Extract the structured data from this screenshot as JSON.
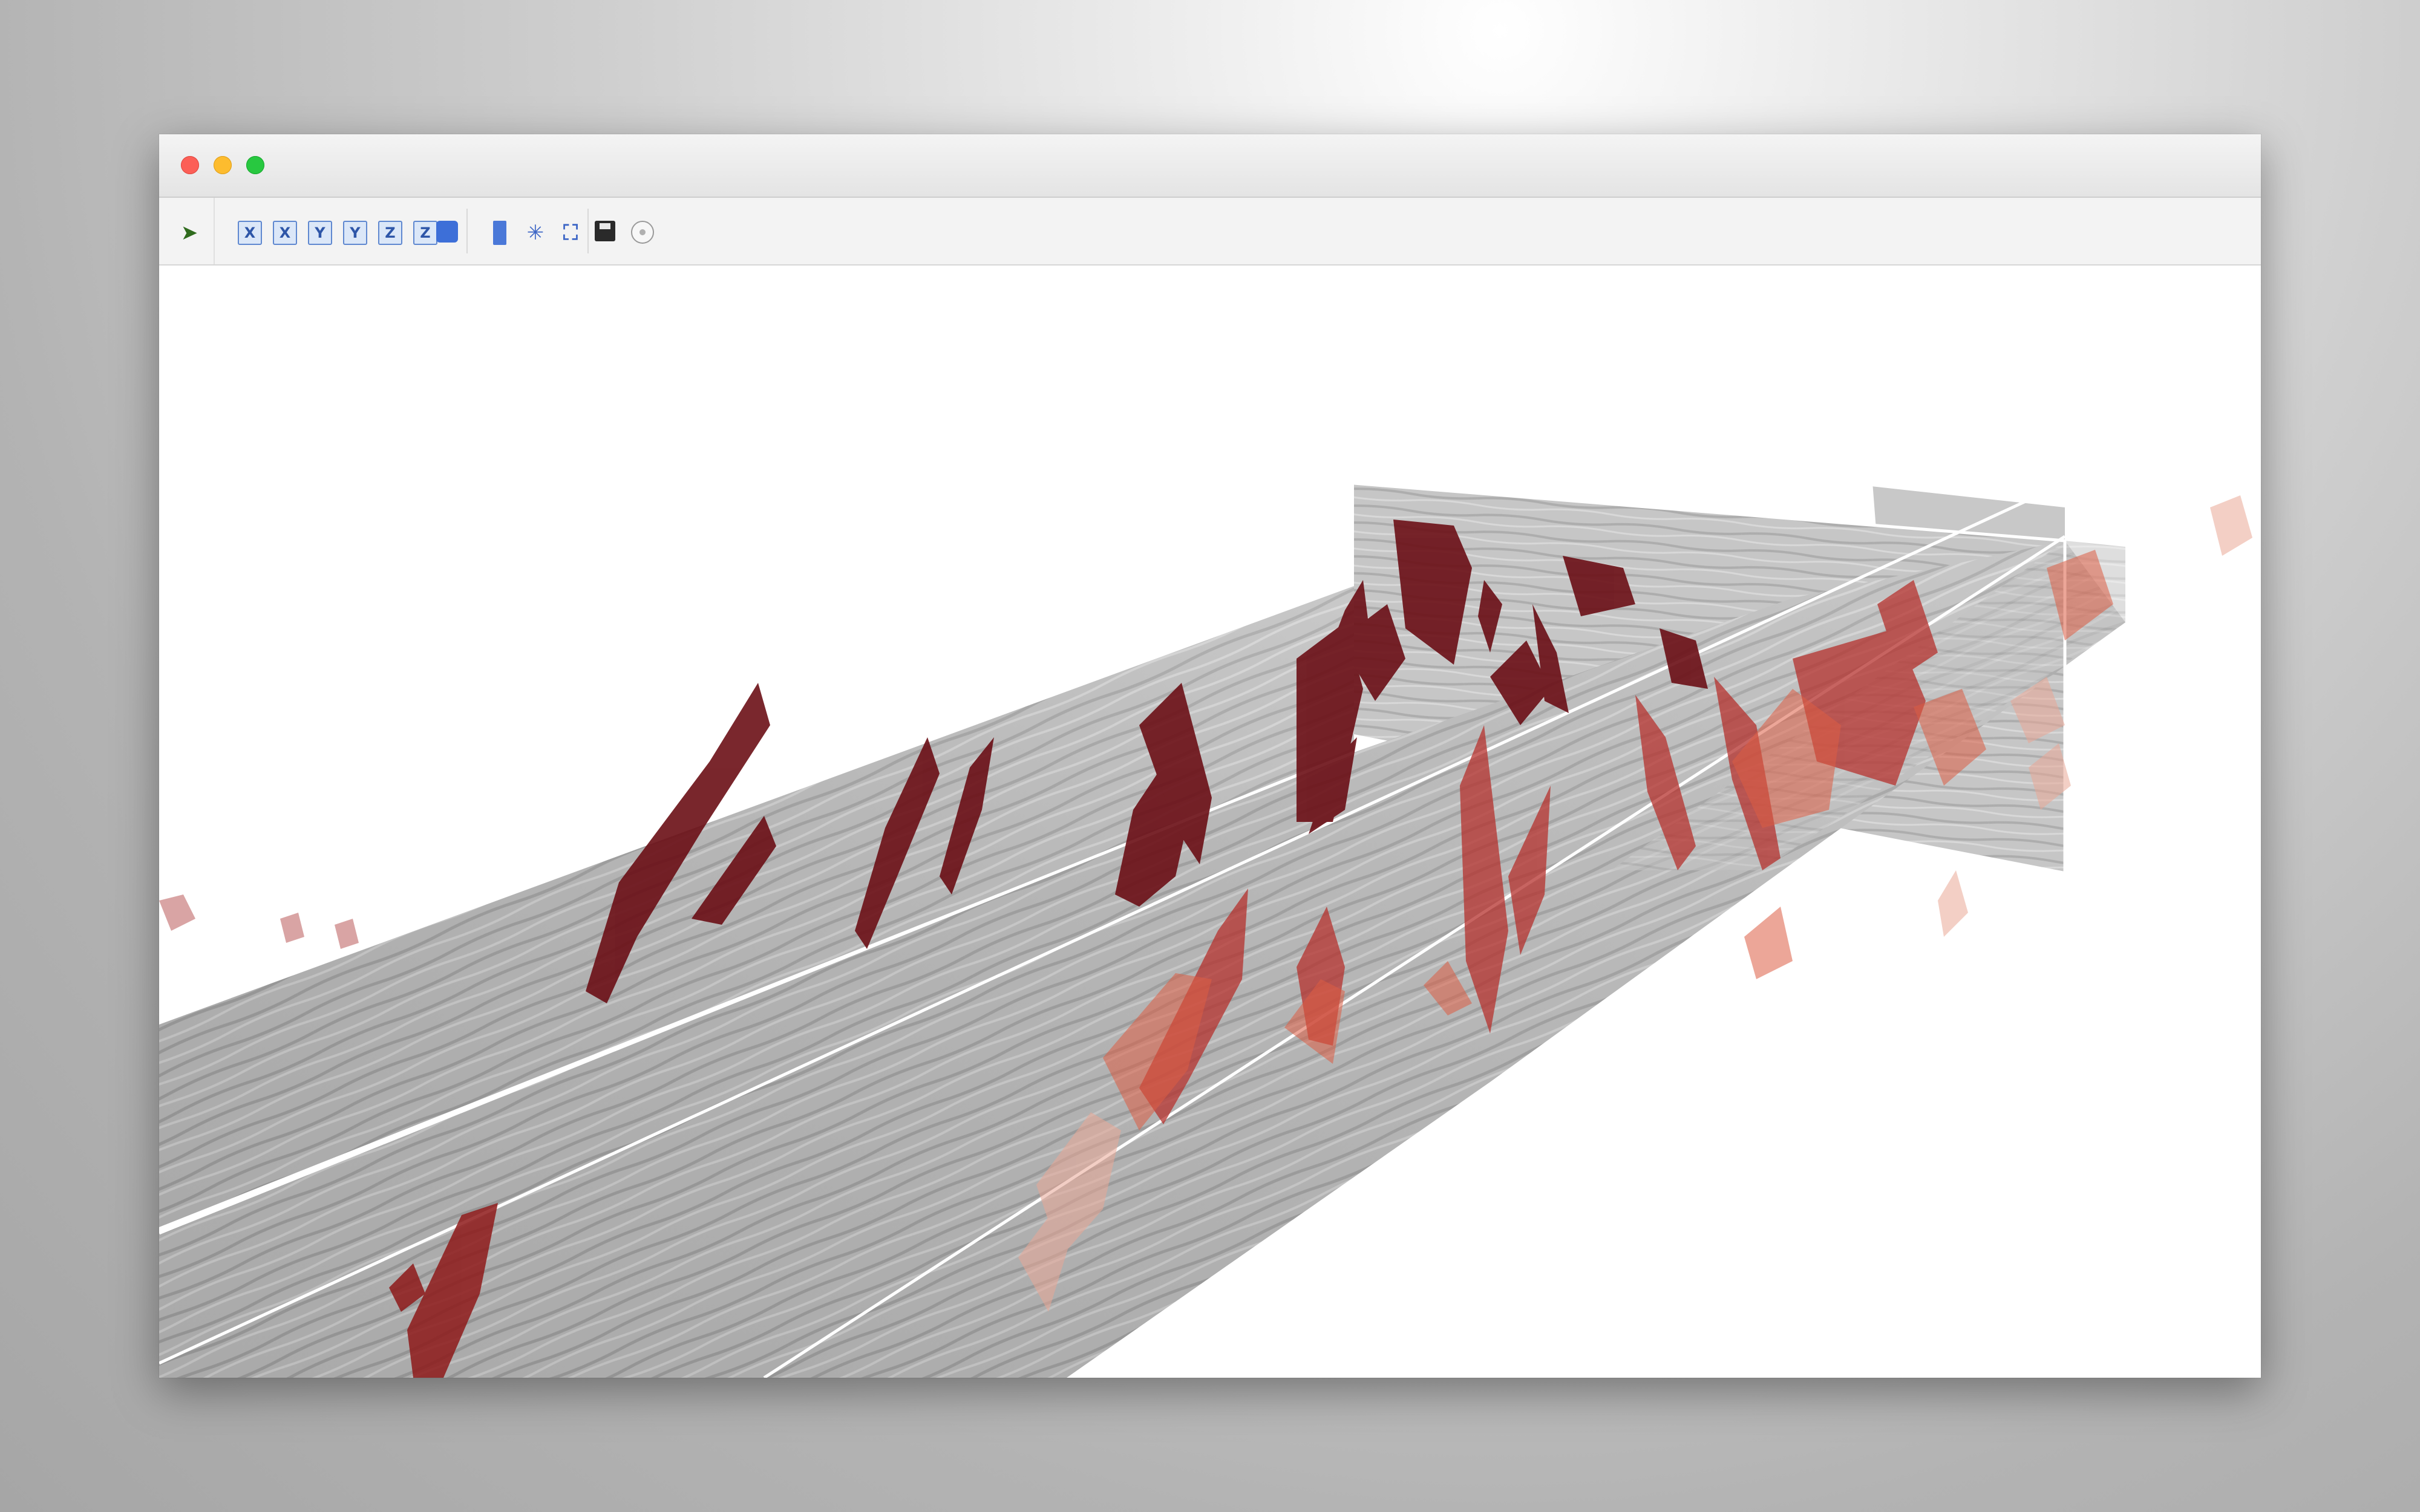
{
  "app": {
    "window_controls": [
      "close",
      "minimize",
      "zoom"
    ]
  },
  "toolbar": {
    "groups": [
      [
        {
          "name": "pan-tool-icon",
          "glyph": "➤"
        }
      ],
      [
        {
          "name": "view-x-positive-button",
          "glyph": "X"
        },
        {
          "name": "view-x-negative-button",
          "glyph": "X"
        },
        {
          "name": "view-y-positive-button",
          "glyph": "Y"
        },
        {
          "name": "view-y-negative-button",
          "glyph": "Y"
        },
        {
          "name": "view-z-positive-button",
          "glyph": "Z"
        },
        {
          "name": "view-z-negative-button",
          "glyph": "Z"
        },
        {
          "name": "view-3d-cube-button",
          "glyph": ""
        }
      ],
      [
        {
          "name": "slice-toggle-button",
          "glyph": ""
        },
        {
          "name": "axes-toggle-button",
          "glyph": "✳"
        },
        {
          "name": "fit-view-button",
          "glyph": "⛶"
        }
      ],
      [
        {
          "name": "save-image-button",
          "glyph": ""
        },
        {
          "name": "settings-button",
          "glyph": ""
        }
      ]
    ]
  },
  "scene": {
    "description_colors": {
      "section_fill": "#b9b9b9",
      "section_edge": "#ffffff",
      "fault_dark": "#6b0f16",
      "fault_mid": "#a82a2a",
      "fault_light": "#d9553b",
      "fault_faint": "#efb1a0"
    }
  }
}
